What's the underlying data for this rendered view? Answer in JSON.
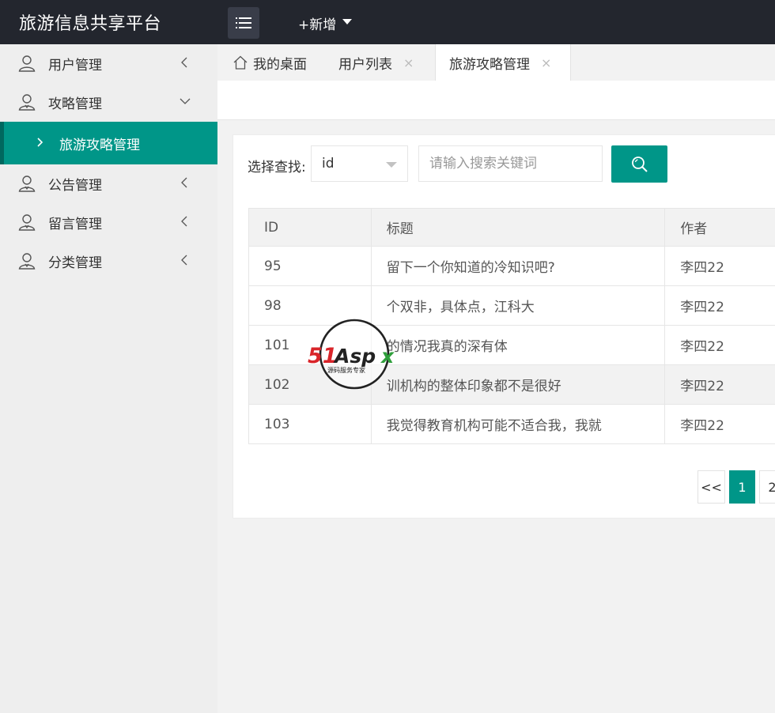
{
  "header": {
    "logo": "旅游信息共享平台",
    "menu_toggle_icon": "list-icon",
    "add_new": "+新增"
  },
  "sidebar": {
    "items": [
      {
        "label": "用户管理",
        "icon": "user-icon",
        "chevron": "chevron-left"
      },
      {
        "label": "攻略管理",
        "icon": "user-icon",
        "chevron": "chevron-down"
      },
      {
        "label": "旅游攻略管理",
        "sub": true
      },
      {
        "label": "公告管理",
        "icon": "user-icon",
        "chevron": "chevron-left"
      },
      {
        "label": "留言管理",
        "icon": "user-icon",
        "chevron": "chevron-left"
      },
      {
        "label": "分类管理",
        "icon": "user-icon",
        "chevron": "chevron-left"
      }
    ],
    "active_color": "#009688"
  },
  "tabs": [
    {
      "label": "我的桌面",
      "icon": "home-icon"
    },
    {
      "label": "用户列表",
      "close": "×"
    },
    {
      "label": "旅游攻略管理",
      "close": "×",
      "active": true
    }
  ],
  "search": {
    "label": "选择查找:",
    "field_value": "id",
    "placeholder": "请输入搜索关键词"
  },
  "table": {
    "columns": [
      "ID",
      "标题",
      "作者"
    ],
    "rows": [
      {
        "id": "95",
        "title": "留下一个你知道的冷知识吧?",
        "author": "李四22"
      },
      {
        "id": "98",
        "title": "个双非，具体点，江科大",
        "author": "李四22"
      },
      {
        "id": "101",
        "title": "的情况我真的深有体",
        "author": "李四22"
      },
      {
        "id": "102",
        "title": "训机构的整体印象都不是很好",
        "author": "李四22"
      },
      {
        "id": "103",
        "title": "我觉得教育机构可能不适合我，我就",
        "author": "李四22"
      }
    ]
  },
  "pagination": {
    "prev": "<<",
    "current": "1",
    "next_page": "2"
  },
  "watermark": {
    "brand": "51Aspx",
    "tagline": "源码服务专家"
  }
}
